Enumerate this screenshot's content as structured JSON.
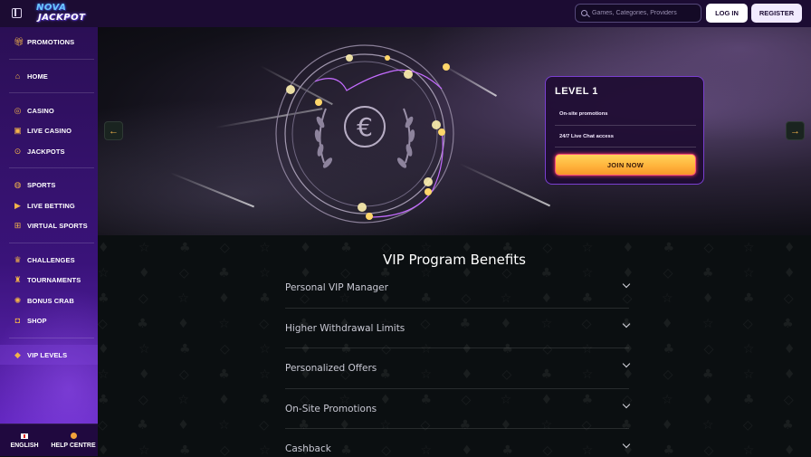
{
  "header": {
    "logo_line1": "NOVA",
    "logo_line2": "JACKPOT",
    "search_placeholder": "Games, Categories, Providers",
    "login_label": "LOG IN",
    "register_label": "REGISTER"
  },
  "sidebar": {
    "items": [
      {
        "label": "PROMOTIONS",
        "icon": "gift-icon"
      },
      {
        "label": "HOME",
        "icon": "home-icon"
      },
      {
        "label": "CASINO",
        "icon": "chip-icon"
      },
      {
        "label": "LIVE CASINO",
        "icon": "live-icon"
      },
      {
        "label": "JACKPOTS",
        "icon": "jackpot-icon"
      },
      {
        "label": "SPORTS",
        "icon": "ball-icon"
      },
      {
        "label": "LIVE BETTING",
        "icon": "play-icon"
      },
      {
        "label": "VIRTUAL SPORTS",
        "icon": "virtual-icon"
      },
      {
        "label": "CHALLENGES",
        "icon": "trophy-icon"
      },
      {
        "label": "TOURNAMENTS",
        "icon": "tournament-icon"
      },
      {
        "label": "BONUS CRAB",
        "icon": "crab-icon"
      },
      {
        "label": "SHOP",
        "icon": "bag-icon"
      },
      {
        "label": "VIP LEVELS",
        "icon": "vip-icon"
      }
    ],
    "language_label": "ENGLISH",
    "help_label": "HELP CENTRE"
  },
  "hero": {
    "level_title": "LEVEL 1",
    "perks": [
      "On-site promotions",
      "24/7 Live Chat access"
    ],
    "join_label": "JOIN NOW",
    "prev_arrow": "←",
    "next_arrow": "→"
  },
  "benefits": {
    "title": "VIP Program Benefits",
    "items": [
      "Personal VIP Manager",
      "Higher Withdrawal Limits",
      "Personalized Offers",
      "On-Site Promotions",
      "Cashback"
    ]
  },
  "colors": {
    "accent_gold": "#f2b34a",
    "sidebar_purple": "#3a137a",
    "card_border": "#7a3fd0"
  }
}
